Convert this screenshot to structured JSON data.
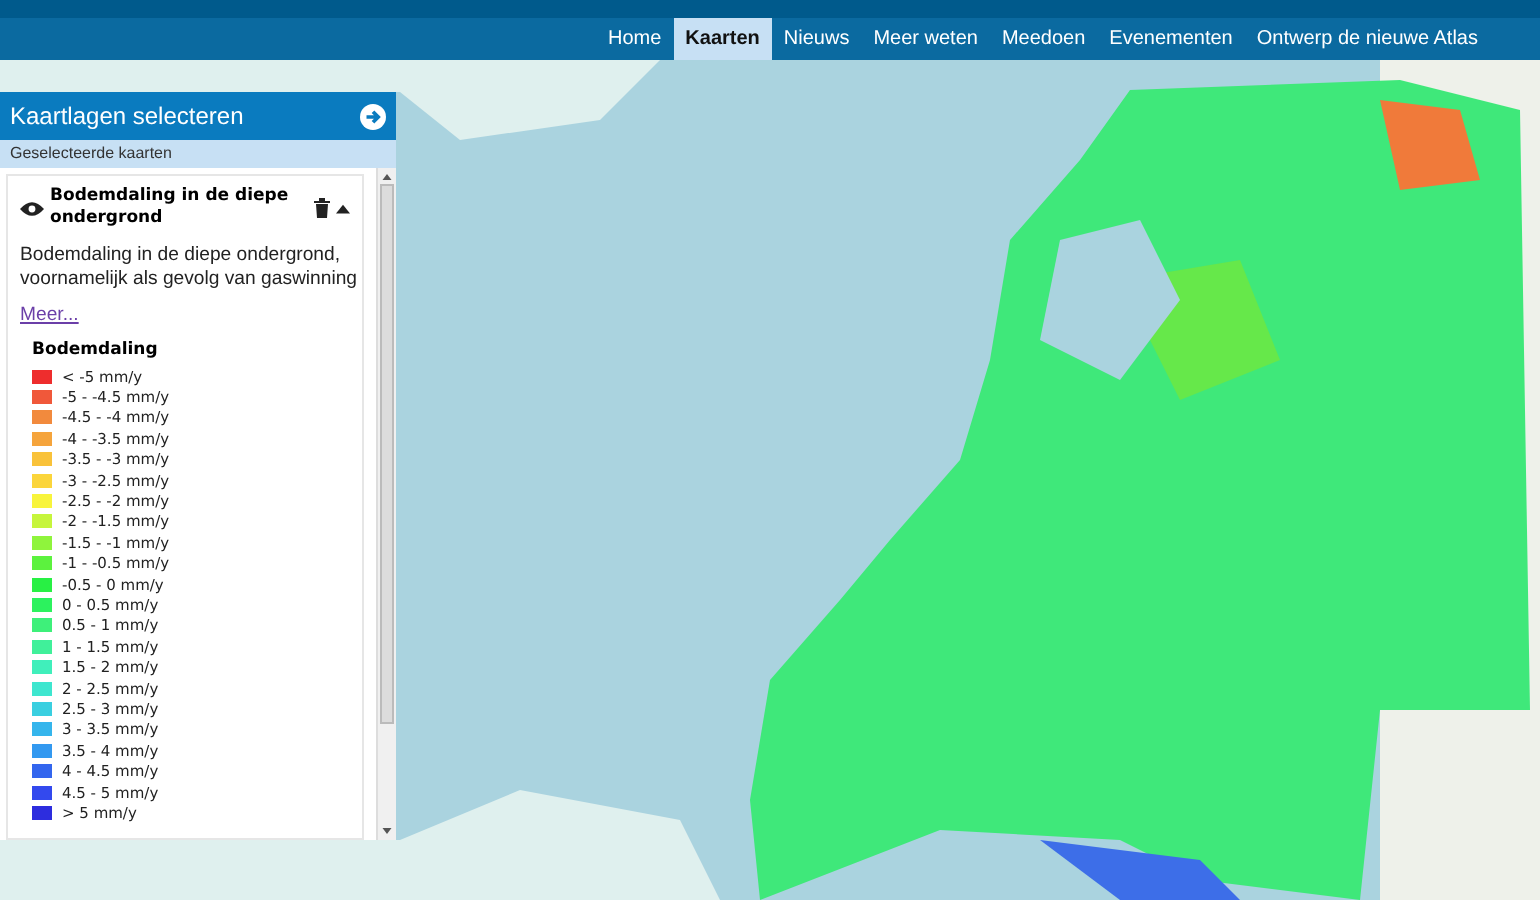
{
  "nav": {
    "items": [
      {
        "label": "Home",
        "selected": false
      },
      {
        "label": "Kaarten",
        "selected": true
      },
      {
        "label": "Nieuws",
        "selected": false
      },
      {
        "label": "Meer weten",
        "selected": false
      },
      {
        "label": "Meedoen",
        "selected": false
      },
      {
        "label": "Evenementen",
        "selected": false
      },
      {
        "label": "Ontwerp de nieuwe Atlas",
        "selected": false
      }
    ]
  },
  "sidebar": {
    "title": "Kaartlagen selecteren",
    "subtitle": "Geselecteerde kaarten",
    "layer": {
      "title": "Bodemdaling in de diepe ondergrond",
      "description": "Bodemdaling in de diepe ondergrond, voornamelijk als gevolg van gaswinning",
      "more_link": "Meer...",
      "legend": {
        "title": "Bodemdaling",
        "items": [
          {
            "label": "< -5 mm/y",
            "color": "#ee2d2d"
          },
          {
            "label": "-5 - -4.5 mm/y",
            "color": "#f0583a"
          },
          {
            "label": "-4.5 - -4 mm/y",
            "color": "#f28a3d"
          },
          {
            "label": "-4 - -3.5 mm/y",
            "color": "#f5a43c"
          },
          {
            "label": "-3.5 - -3 mm/y",
            "color": "#f9c23a"
          },
          {
            "label": "-3 - -2.5 mm/y",
            "color": "#fbd53b"
          },
          {
            "label": "-2.5 - -2 mm/y",
            "color": "#f8f43c"
          },
          {
            "label": "-2 - -1.5 mm/y",
            "color": "#c6f53c"
          },
          {
            "label": "-1.5 - -1 mm/y",
            "color": "#8ff43c"
          },
          {
            "label": "-1 - -0.5 mm/y",
            "color": "#5cf23e"
          },
          {
            "label": "-0.5 - 0 mm/y",
            "color": "#28f044"
          },
          {
            "label": "0 - 0.5 mm/y",
            "color": "#2cf25e"
          },
          {
            "label": "0.5 - 1 mm/y",
            "color": "#3ef07a"
          },
          {
            "label": "1 - 1.5 mm/y",
            "color": "#40f09a"
          },
          {
            "label": "1.5 - 2 mm/y",
            "color": "#40efbb"
          },
          {
            "label": "2 - 2.5 mm/y",
            "color": "#3ee6cf"
          },
          {
            "label": "2.5 - 3 mm/y",
            "color": "#3acfe0"
          },
          {
            "label": "3 - 3.5 mm/y",
            "color": "#35b5ec"
          },
          {
            "label": "3.5 - 4 mm/y",
            "color": "#3399f0"
          },
          {
            "label": "4 - 4.5 mm/y",
            "color": "#3366ee"
          },
          {
            "label": "4.5 - 5 mm/y",
            "color": "#3349ee"
          },
          {
            "label": "> 5 mm/y",
            "color": "#2d2dde"
          }
        ]
      }
    }
  }
}
